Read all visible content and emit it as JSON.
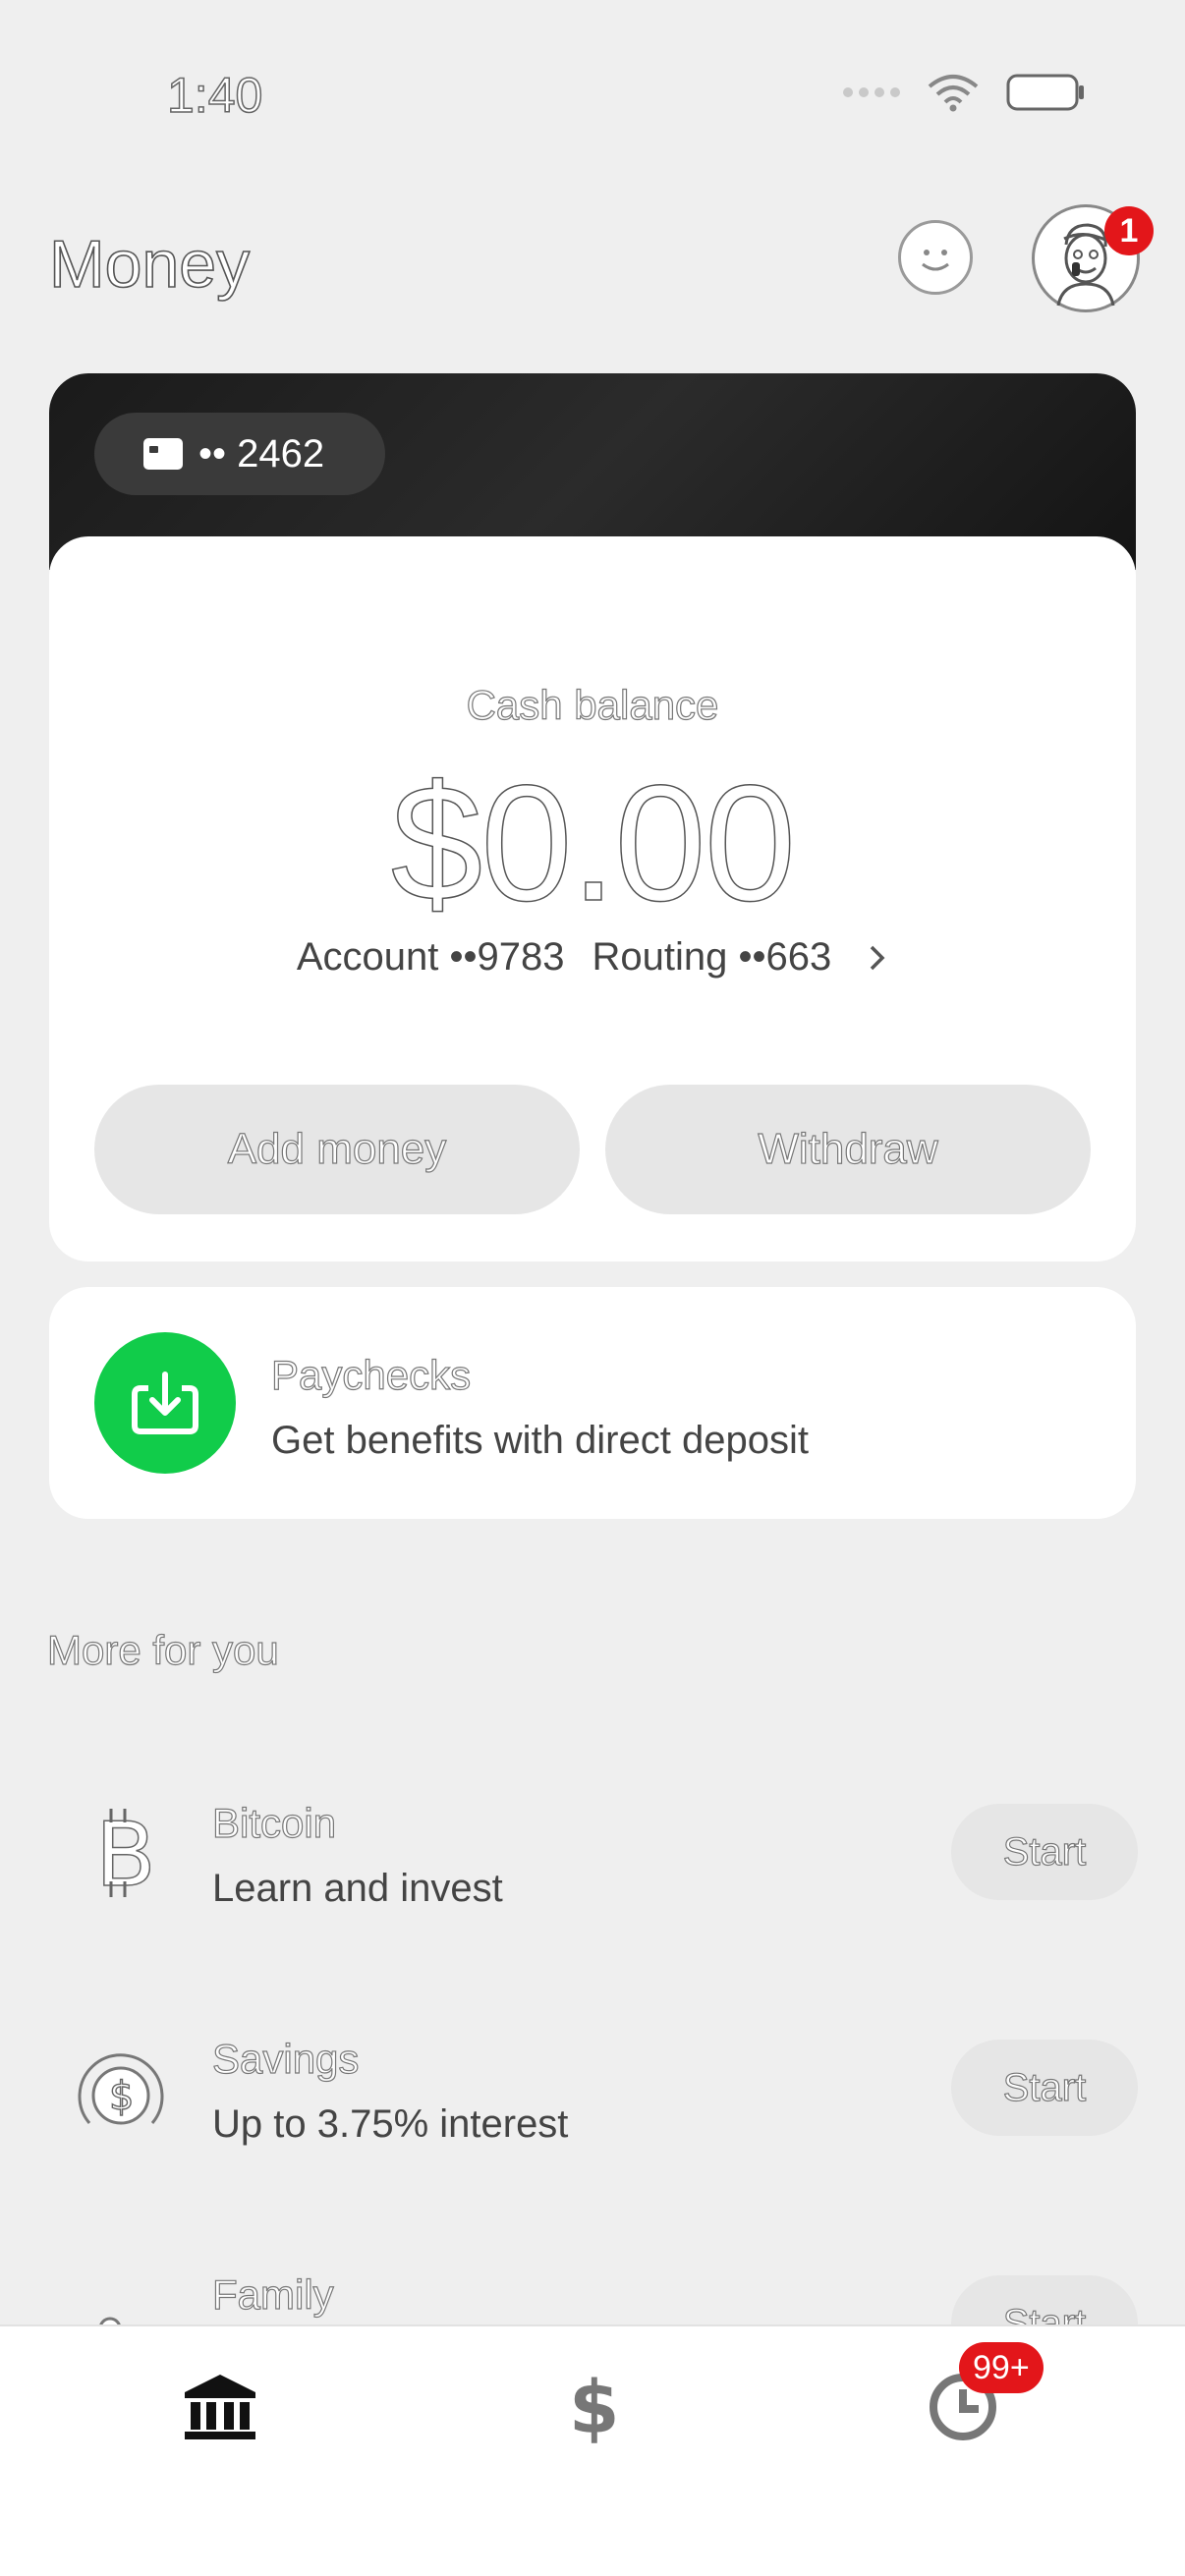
{
  "status_bar": {
    "time": "1:40"
  },
  "header": {
    "title": "Money",
    "notification_count": "1"
  },
  "account_card": {
    "card_number": "•• 2462",
    "balance_label": "Cash balance",
    "balance": "$0.00",
    "account": "Account ••9783",
    "routing": "Routing ••663",
    "add_money": "Add money",
    "withdraw": "Withdraw"
  },
  "paychecks": {
    "title": "Paychecks",
    "subtitle": "Get benefits with direct deposit",
    "accent": "#11cc4a"
  },
  "more_for_you": {
    "title": "More for you",
    "items": [
      {
        "title": "Bitcoin",
        "subtitle": "Learn and invest",
        "button": "Start",
        "icon": "bitcoin-icon"
      },
      {
        "title": "Savings",
        "subtitle": "Up to 3.75% interest",
        "button": "Start",
        "icon": "savings-icon"
      },
      {
        "title": "Family",
        "subtitle": "",
        "button": "Start",
        "icon": "family-icon"
      }
    ]
  },
  "bottom_nav": {
    "items": [
      {
        "icon": "bank-icon"
      },
      {
        "icon": "dollar-icon"
      },
      {
        "icon": "activity-clock-icon",
        "badge": "99+"
      }
    ],
    "badge_color": "#e3161a"
  }
}
